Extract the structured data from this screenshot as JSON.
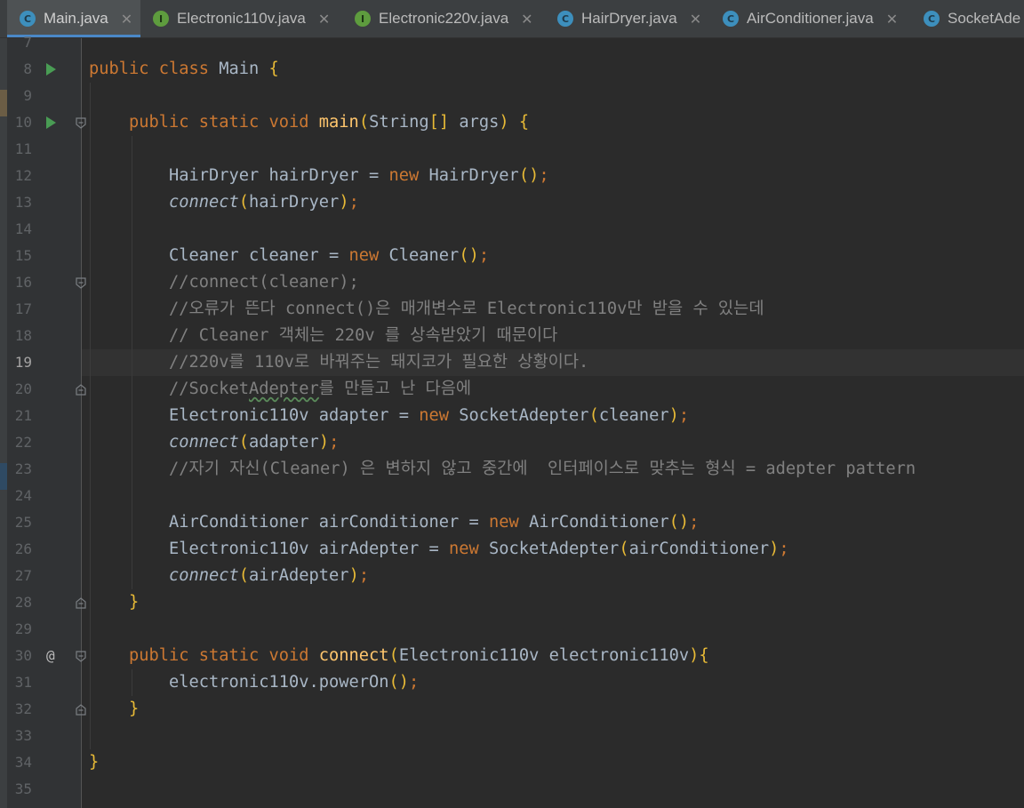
{
  "tabs": [
    {
      "label": "Main.java",
      "icon": "class-icon",
      "active": true
    },
    {
      "label": "Electronic110v.java",
      "icon": "interface-icon",
      "active": false
    },
    {
      "label": "Electronic220v.java",
      "icon": "interface-icon",
      "active": false
    },
    {
      "label": "HairDryer.java",
      "icon": "class-icon",
      "active": false
    },
    {
      "label": "AirConditioner.java",
      "icon": "class-icon",
      "active": false
    },
    {
      "label": "SocketAde",
      "icon": "class-icon",
      "active": false
    }
  ],
  "editor": {
    "current_line": "19",
    "lines": [
      {
        "n": "7",
        "code": [],
        "gutter": ""
      },
      {
        "n": "8",
        "code": [
          [
            "kw",
            "public class "
          ],
          [
            "t",
            "Main "
          ],
          [
            "br",
            "{"
          ]
        ],
        "gutter": "run"
      },
      {
        "n": "9",
        "code": [],
        "gutter": ""
      },
      {
        "n": "10",
        "code": [
          [
            "t",
            "    "
          ],
          [
            "kw",
            "public static void "
          ],
          [
            "fn",
            "main"
          ],
          [
            "br",
            "("
          ],
          [
            "t",
            "String"
          ],
          [
            "br",
            "[]"
          ],
          [
            "t",
            " args"
          ],
          [
            "br",
            ")"
          ],
          [
            "t",
            " "
          ],
          [
            "br",
            "{"
          ]
        ],
        "gutter": "run"
      },
      {
        "n": "11",
        "code": [],
        "gutter": ""
      },
      {
        "n": "12",
        "code": [
          [
            "t",
            "        HairDryer hairDryer = "
          ],
          [
            "kw",
            "new "
          ],
          [
            "t",
            "HairDryer"
          ],
          [
            "br",
            "()"
          ],
          [
            "kw",
            ";"
          ]
        ],
        "gutter": ""
      },
      {
        "n": "13",
        "code": [
          [
            "t",
            "        "
          ],
          [
            "it",
            "connect"
          ],
          [
            "br",
            "("
          ],
          [
            "t",
            "hairDryer"
          ],
          [
            "br",
            ")"
          ],
          [
            "kw",
            ";"
          ]
        ],
        "gutter": ""
      },
      {
        "n": "14",
        "code": [],
        "gutter": ""
      },
      {
        "n": "15",
        "code": [
          [
            "t",
            "        Cleaner cleaner = "
          ],
          [
            "kw",
            "new "
          ],
          [
            "t",
            "Cleaner"
          ],
          [
            "br",
            "()"
          ],
          [
            "kw",
            ";"
          ]
        ],
        "gutter": ""
      },
      {
        "n": "16",
        "code": [
          [
            "t",
            "        "
          ],
          [
            "cm",
            "//connect(cleaner);"
          ]
        ],
        "gutter": ""
      },
      {
        "n": "17",
        "code": [
          [
            "t",
            "        "
          ],
          [
            "cm",
            "//오류가 뜬다 connect()은 매개변수로 Electronic110v만 받을 수 있는데"
          ]
        ],
        "gutter": ""
      },
      {
        "n": "18",
        "code": [
          [
            "t",
            "        "
          ],
          [
            "cm",
            "// Cleaner 객체는 220v 를 상속받았기 때문이다"
          ]
        ],
        "gutter": ""
      },
      {
        "n": "19",
        "code": [
          [
            "t",
            "        "
          ],
          [
            "cm",
            "//220v를 110v로 바꿔주는 돼지코가 필요한 상황이다."
          ]
        ],
        "gutter": ""
      },
      {
        "n": "20",
        "code": [
          [
            "t",
            "        "
          ],
          [
            "cm",
            "//Socket"
          ],
          [
            "cmw",
            "Adepter"
          ],
          [
            "cm",
            "를 만들고 난 다음에"
          ]
        ],
        "gutter": ""
      },
      {
        "n": "21",
        "code": [
          [
            "t",
            "        Electronic110v adapter = "
          ],
          [
            "kw",
            "new "
          ],
          [
            "t",
            "SocketAdepter"
          ],
          [
            "br",
            "("
          ],
          [
            "t",
            "cleaner"
          ],
          [
            "br",
            ")"
          ],
          [
            "kw",
            ";"
          ]
        ],
        "gutter": ""
      },
      {
        "n": "22",
        "code": [
          [
            "t",
            "        "
          ],
          [
            "it",
            "connect"
          ],
          [
            "br",
            "("
          ],
          [
            "t",
            "adapter"
          ],
          [
            "br",
            ")"
          ],
          [
            "kw",
            ";"
          ]
        ],
        "gutter": ""
      },
      {
        "n": "23",
        "code": [
          [
            "t",
            "        "
          ],
          [
            "cm",
            "//자기 자신(Cleaner) 은 변하지 않고 중간에  인터페이스로 맞추는 형식 = adepter pattern"
          ]
        ],
        "gutter": ""
      },
      {
        "n": "24",
        "code": [],
        "gutter": ""
      },
      {
        "n": "25",
        "code": [
          [
            "t",
            "        AirConditioner airConditioner = "
          ],
          [
            "kw",
            "new "
          ],
          [
            "t",
            "AirConditioner"
          ],
          [
            "br",
            "()"
          ],
          [
            "kw",
            ";"
          ]
        ],
        "gutter": ""
      },
      {
        "n": "26",
        "code": [
          [
            "t",
            "        Electronic110v airAdepter = "
          ],
          [
            "kw",
            "new "
          ],
          [
            "t",
            "SocketAdepter"
          ],
          [
            "br",
            "("
          ],
          [
            "t",
            "airConditioner"
          ],
          [
            "br",
            ")"
          ],
          [
            "kw",
            ";"
          ]
        ],
        "gutter": ""
      },
      {
        "n": "27",
        "code": [
          [
            "t",
            "        "
          ],
          [
            "it",
            "connect"
          ],
          [
            "br",
            "("
          ],
          [
            "t",
            "airAdepter"
          ],
          [
            "br",
            ")"
          ],
          [
            "kw",
            ";"
          ]
        ],
        "gutter": ""
      },
      {
        "n": "28",
        "code": [
          [
            "t",
            "    "
          ],
          [
            "br",
            "}"
          ]
        ],
        "gutter": ""
      },
      {
        "n": "29",
        "code": [],
        "gutter": ""
      },
      {
        "n": "30",
        "code": [
          [
            "t",
            "    "
          ],
          [
            "kw",
            "public static void "
          ],
          [
            "fn",
            "connect"
          ],
          [
            "br",
            "("
          ],
          [
            "t",
            "Electronic110v electronic110v"
          ],
          [
            "br",
            ")"
          ],
          [
            "br",
            "{"
          ]
        ],
        "gutter": "at"
      },
      {
        "n": "31",
        "code": [
          [
            "t",
            "        electronic110v.powerOn"
          ],
          [
            "br",
            "()"
          ],
          [
            "kw",
            ";"
          ]
        ],
        "gutter": ""
      },
      {
        "n": "32",
        "code": [
          [
            "t",
            "    "
          ],
          [
            "br",
            "}"
          ]
        ],
        "gutter": ""
      },
      {
        "n": "33",
        "code": [],
        "gutter": ""
      },
      {
        "n": "34",
        "code": [
          [
            "br",
            "}"
          ]
        ],
        "gutter": ""
      },
      {
        "n": "35",
        "code": [],
        "gutter": ""
      }
    ]
  }
}
